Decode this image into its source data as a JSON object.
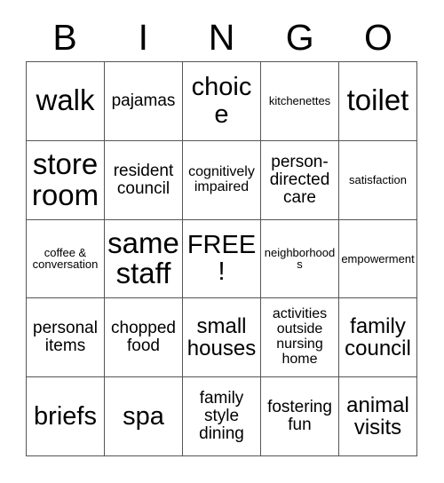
{
  "card": {
    "header_letters": [
      "B",
      "I",
      "N",
      "G",
      "O"
    ],
    "free_space_label": "FREE!",
    "grid": [
      [
        {
          "text": "walk",
          "size": "s-xxl"
        },
        {
          "text": "pajamas",
          "size": "s-md"
        },
        {
          "text": "choice",
          "size": "s-xl"
        },
        {
          "text": "kitchenettes",
          "size": "s-xs"
        },
        {
          "text": "toilet",
          "size": "s-xxl"
        }
      ],
      [
        {
          "text": "store\nroom",
          "size": "s-xxl"
        },
        {
          "text": "resident\ncouncil",
          "size": "s-md"
        },
        {
          "text": "cognitively\nimpaired",
          "size": "s-sm"
        },
        {
          "text": "person-\ndirected\ncare",
          "size": "s-md"
        },
        {
          "text": "satisfaction",
          "size": "s-xs"
        }
      ],
      [
        {
          "text": "coffee &\nconversation",
          "size": "s-xs"
        },
        {
          "text": "same\nstaff",
          "size": "s-xxl"
        },
        {
          "text": "FREE!",
          "size": "s-xl"
        },
        {
          "text": "neighborhoods",
          "size": "s-xs"
        },
        {
          "text": "empowerment",
          "size": "s-xs"
        }
      ],
      [
        {
          "text": "personal\nitems",
          "size": "s-md"
        },
        {
          "text": "chopped\nfood",
          "size": "s-md"
        },
        {
          "text": "small\nhouses",
          "size": "s-lg"
        },
        {
          "text": "activities\noutside\nnursing\nhome",
          "size": "s-sm"
        },
        {
          "text": "family\ncouncil",
          "size": "s-lg"
        }
      ],
      [
        {
          "text": "briefs",
          "size": "s-xl"
        },
        {
          "text": "spa",
          "size": "s-xl"
        },
        {
          "text": "family\nstyle\ndining",
          "size": "s-md"
        },
        {
          "text": "fostering\nfun",
          "size": "s-md"
        },
        {
          "text": "animal\nvisits",
          "size": "s-lg"
        }
      ]
    ],
    "colors": {
      "background": "#ffffff",
      "text": "#000000",
      "grid_line": "#555555"
    }
  }
}
